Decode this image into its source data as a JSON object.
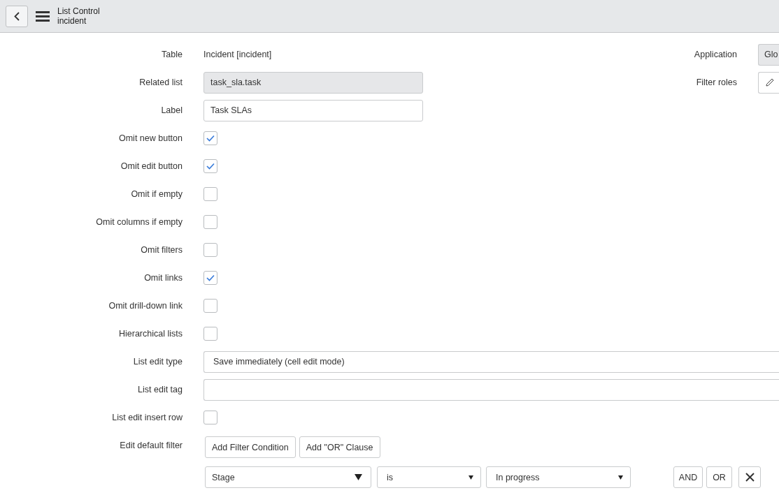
{
  "header": {
    "title": "List Control",
    "subtitle": "incident"
  },
  "fields": [
    {
      "kind": "text",
      "label": "Table",
      "value": "Incident [incident]"
    },
    {
      "kind": "readonly",
      "label": "Related list",
      "value": "task_sla.task"
    },
    {
      "kind": "input",
      "label": "Label",
      "value": "Task SLAs"
    },
    {
      "kind": "checkbox",
      "label": "Omit new button",
      "checked": true
    },
    {
      "kind": "checkbox",
      "label": "Omit edit button",
      "checked": true
    },
    {
      "kind": "checkbox",
      "label": "Omit if empty",
      "checked": false
    },
    {
      "kind": "checkbox",
      "label": "Omit columns if empty",
      "checked": false
    },
    {
      "kind": "checkbox",
      "label": "Omit filters",
      "checked": false
    },
    {
      "kind": "checkbox",
      "label": "Omit links",
      "checked": true
    },
    {
      "kind": "checkbox",
      "label": "Omit drill-down link",
      "checked": false
    },
    {
      "kind": "checkbox",
      "label": "Hierarchical lists",
      "checked": false
    },
    {
      "kind": "select",
      "label": "List edit type",
      "value": "Save immediately (cell edit mode)"
    },
    {
      "kind": "wide_input",
      "label": "List edit tag"
    },
    {
      "kind": "checkbox",
      "label": "List edit insert row",
      "checked": false
    }
  ],
  "side_fields": [
    {
      "kind": "readonly",
      "label": "Application",
      "value": "Glo"
    },
    {
      "kind": "edit_button",
      "label": "Filter roles"
    }
  ],
  "default_filter": {
    "label": "Edit default filter",
    "buttons": [
      "Add Filter Condition",
      "Add \"OR\" Clause"
    ],
    "condition": {
      "field": "Stage",
      "operator": "is",
      "value": "In progress"
    },
    "condition_buttons": [
      "AND",
      "OR"
    ]
  }
}
